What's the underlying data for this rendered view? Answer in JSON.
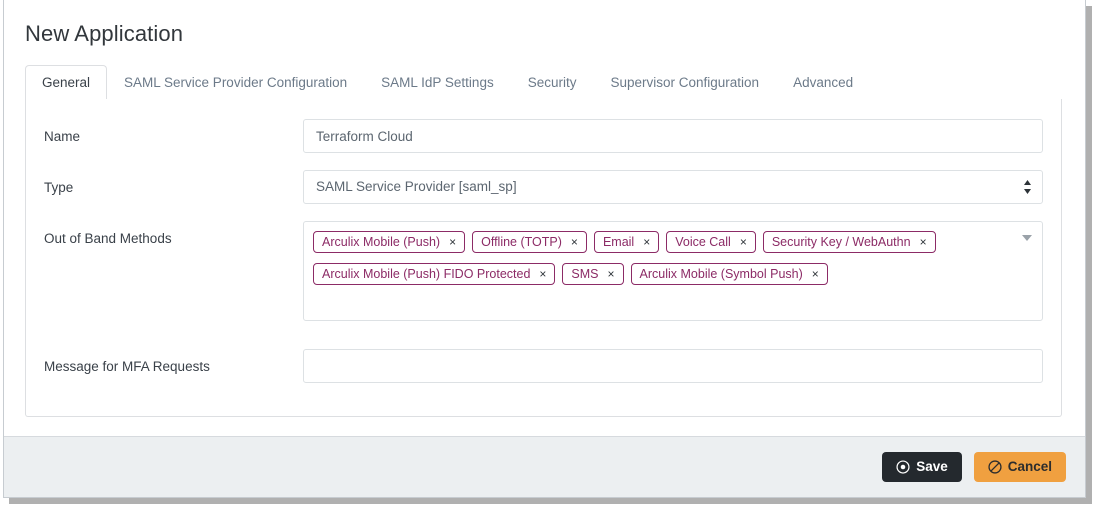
{
  "window": {
    "title": "New Application"
  },
  "tabs": [
    {
      "label": "General",
      "active": true
    },
    {
      "label": "SAML Service Provider Configuration",
      "active": false
    },
    {
      "label": "SAML IdP Settings",
      "active": false
    },
    {
      "label": "Security",
      "active": false
    },
    {
      "label": "Supervisor Configuration",
      "active": false
    },
    {
      "label": "Advanced",
      "active": false
    }
  ],
  "form": {
    "name": {
      "label": "Name",
      "value": "Terraform Cloud",
      "placeholder": ""
    },
    "type": {
      "label": "Type",
      "value": "SAML Service Provider [saml_sp]",
      "options": [
        "SAML Service Provider [saml_sp]"
      ]
    },
    "out_of_band_methods": {
      "label": "Out of Band Methods",
      "chips": [
        {
          "label": "Arculix Mobile (Push)",
          "remove": "×"
        },
        {
          "label": "Offline (TOTP)",
          "remove": "×"
        },
        {
          "label": "Email",
          "remove": "×"
        },
        {
          "label": "Voice Call",
          "remove": "×"
        },
        {
          "label": "Security Key / WebAuthn",
          "remove": "×"
        },
        {
          "label": "Arculix Mobile (Push) FIDO Protected",
          "remove": "×"
        },
        {
          "label": "SMS",
          "remove": "×"
        },
        {
          "label": "Arculix Mobile (Symbol Push)",
          "remove": "×"
        }
      ]
    },
    "message_for_mfa_requests": {
      "label": "Message for MFA Requests",
      "value": "",
      "placeholder": ""
    }
  },
  "footer": {
    "save": {
      "label": "Save",
      "icon": "dot-circle-icon"
    },
    "cancel": {
      "label": "Cancel",
      "icon": "ban-icon"
    }
  },
  "colors": {
    "chip_accent": "#8c2b66",
    "save_bg": "#24292e",
    "cancel_bg": "#f0a040",
    "footer_bg": "#eceff1",
    "panel_border": "#dddfe2"
  }
}
